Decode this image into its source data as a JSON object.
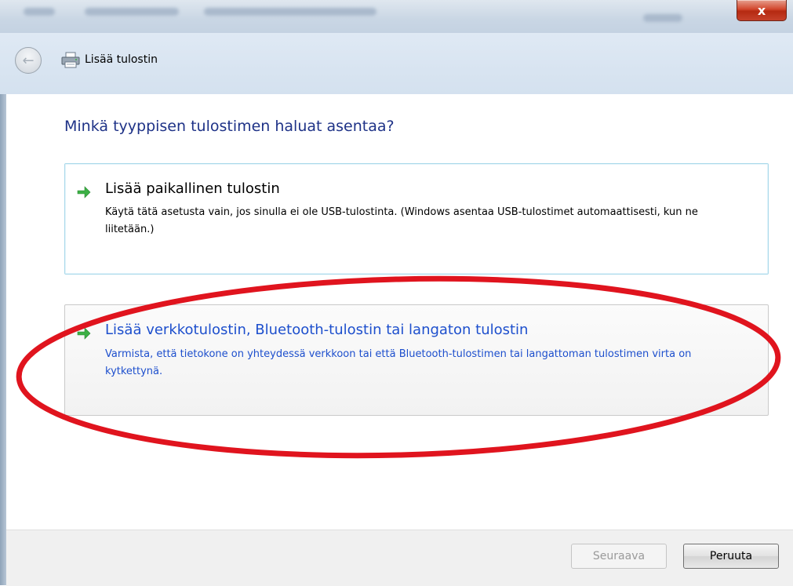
{
  "window": {
    "title": "Lisää tulostin",
    "close_label": "x"
  },
  "main": {
    "heading": "Minkä tyyppisen tulostimen haluat asentaa?",
    "options": [
      {
        "title": "Lisää paikallinen tulostin",
        "description": "Käytä tätä asetusta vain, jos sinulla ei ole USB-tulostinta. (Windows asentaa USB-tulostimet automaattisesti, kun ne liitetään.)"
      },
      {
        "title": "Lisää verkkotulostin, Bluetooth-tulostin tai langaton tulostin",
        "description": "Varmista, että tietokone on yhteydessä verkkoon tai että Bluetooth-tulostimen tai langattoman tulostimen virta on kytkettynä."
      }
    ]
  },
  "footer": {
    "next_label": "Seuraava",
    "cancel_label": "Peruuta"
  },
  "icons": {
    "back": "back-arrow-icon",
    "printer": "printer-icon",
    "option_arrow": "green-arrow-icon"
  },
  "colors": {
    "heading": "#1e3287",
    "link_hover": "#1d4fcd",
    "arrow_green": "#3cb045",
    "annotation_red": "#e0141e"
  }
}
